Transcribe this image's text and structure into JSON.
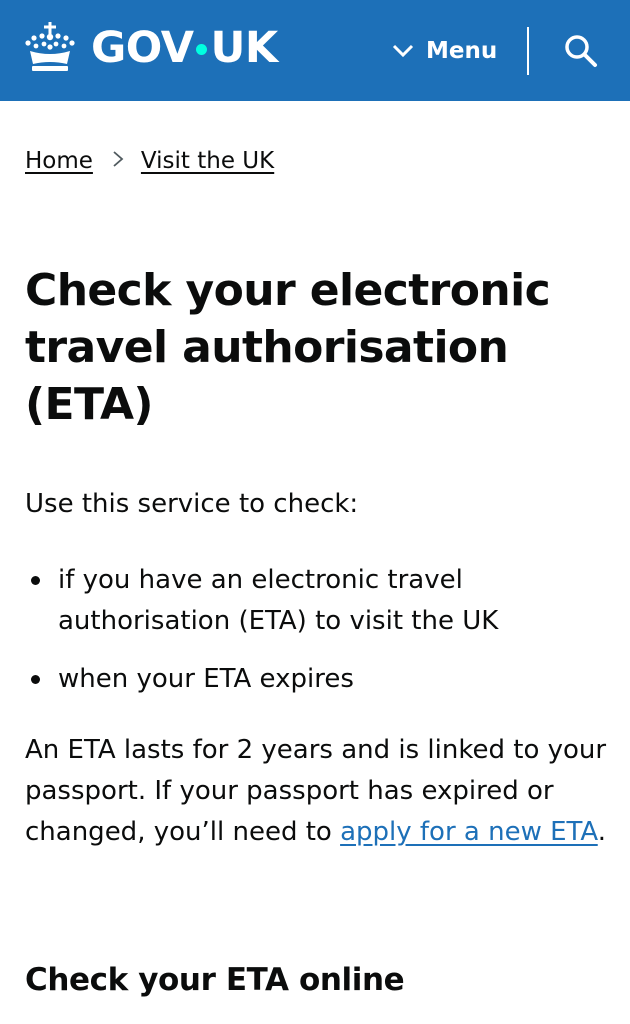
{
  "header": {
    "logo_text_left": "GOV",
    "logo_text_right": "UK",
    "menu_label": "Menu",
    "menu_icon": "chevron-down-icon",
    "search_icon": "search-icon",
    "brand_color": "#1d70b8",
    "dot_color": "#00ffe0"
  },
  "breadcrumb": {
    "items": [
      {
        "label": "Home"
      },
      {
        "label": "Visit the UK"
      }
    ],
    "separator": ">"
  },
  "main": {
    "title": "Check your electronic travel authorisation (ETA)",
    "intro": "Use this service to check:",
    "bullets": [
      "if you have an electronic travel authorisation (ETA) to visit the UK",
      "when your ETA expires"
    ],
    "paragraph_before_link": "An ETA lasts for 2 years and is linked to your passport. If your passport has expired or changed, you’ll need to ",
    "paragraph_link": "apply for a new ETA",
    "paragraph_after_link": ".",
    "subheading": "Check your ETA online",
    "link_color": "#1d70b8"
  }
}
